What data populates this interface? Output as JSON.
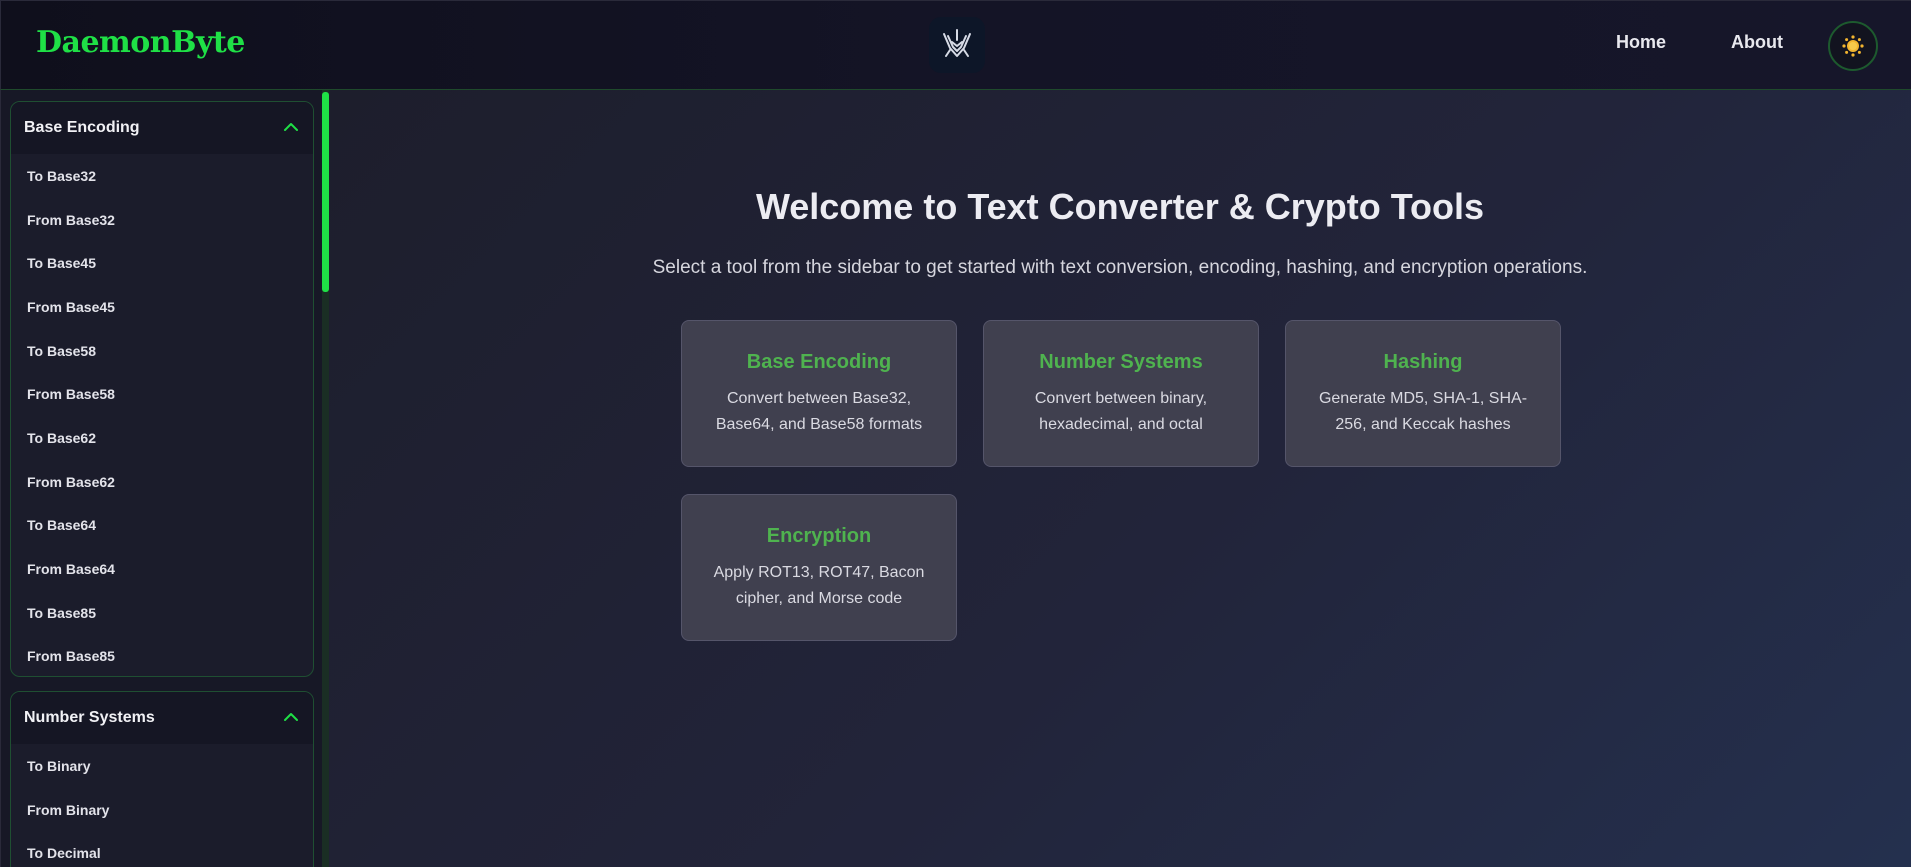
{
  "header": {
    "brand": "DaemonByte",
    "nav": {
      "home": "Home",
      "about": "About"
    },
    "accent_color": "#1fe046",
    "logo_icon": "daemon-crest-icon",
    "theme_icon": "sun-icon"
  },
  "sidebar": {
    "sections": [
      {
        "title": "Base Encoding",
        "expanded": true,
        "items": [
          "To Base32",
          "From Base32",
          "To Base45",
          "From Base45",
          "To Base58",
          "From Base58",
          "To Base62",
          "From Base62",
          "To Base64",
          "From Base64",
          "To Base85",
          "From Base85"
        ]
      },
      {
        "title": "Number Systems",
        "expanded": true,
        "items": [
          "To Binary",
          "From Binary",
          "To Decimal"
        ]
      }
    ]
  },
  "main": {
    "title": "Welcome to Text Converter & Crypto Tools",
    "subtitle": "Select a tool from the sidebar to get started with text conversion, encoding, hashing, and encryption operations.",
    "cards": [
      {
        "title": "Base Encoding",
        "description": "Convert between Base32, Base64, and Base58 formats"
      },
      {
        "title": "Number Systems",
        "description": "Convert between binary, hexadecimal, and octal"
      },
      {
        "title": "Hashing",
        "description": "Generate MD5, SHA-1, SHA-256, and Keccak hashes"
      },
      {
        "title": "Encryption",
        "description": "Apply ROT13, ROT47, Bacon cipher, and Morse code"
      }
    ],
    "card_title_color": "#4fb34f"
  }
}
